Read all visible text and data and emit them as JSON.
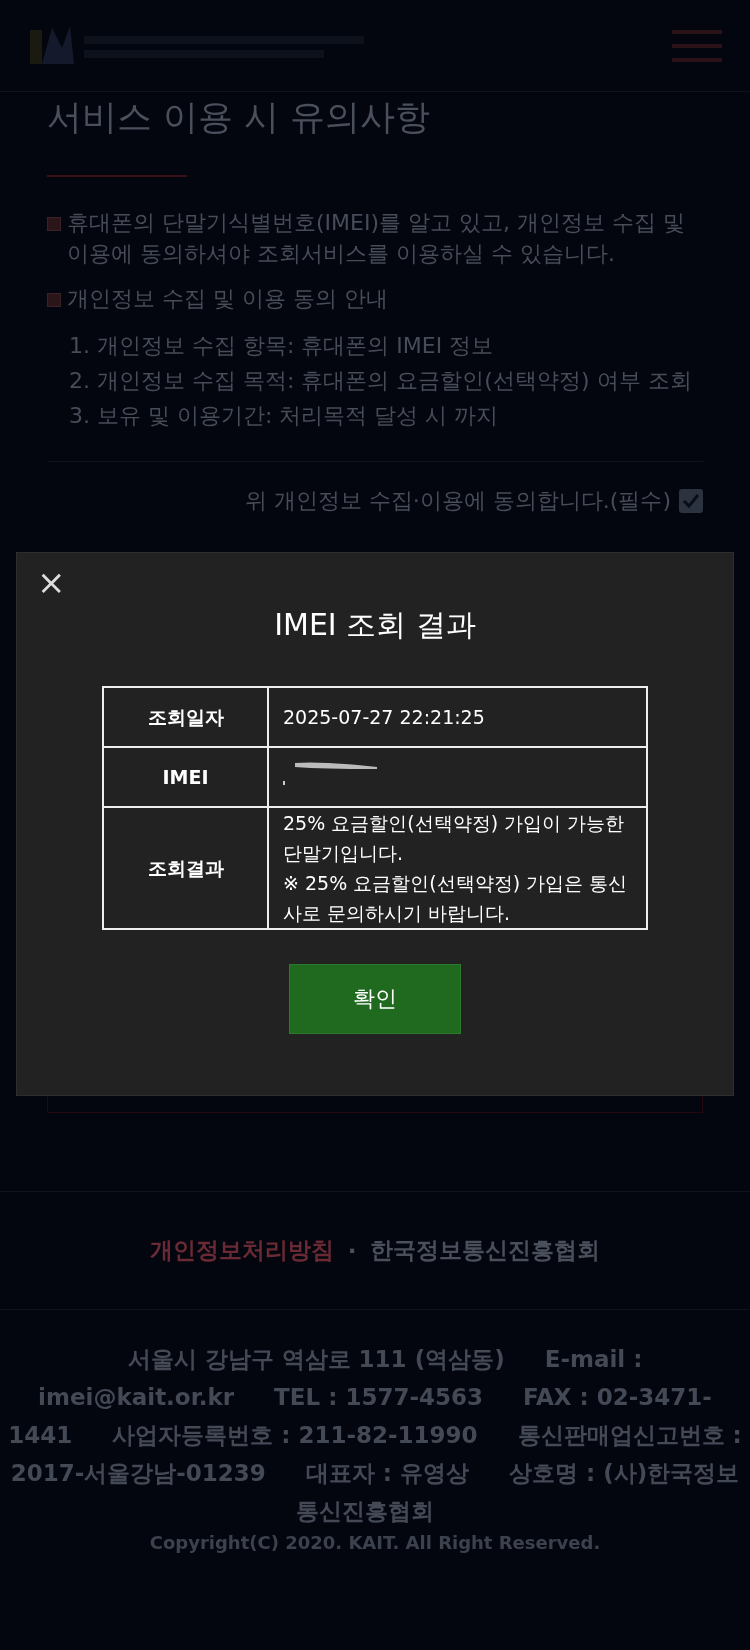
{
  "notice": {
    "title": "서비스 이용 시 유의사항",
    "bullets": [
      "휴대폰의 단말기식별번호(IMEI)를 알고 있고, 개인정보 수집 및 이용에 동의하셔야 조회서비스를 이용하실 수 있습니다.",
      "개인정보 수집 및 이용 동의 안내"
    ],
    "items": [
      "1. 개인정보 수집 항목: 휴대폰의 IMEI 정보",
      "2. 개인정보 수집 목적: 휴대폰의 요금할인(선택약정) 여부 조회",
      "3. 보유 및 이용기간: 처리목적 달성 시 까지"
    ],
    "agreement": {
      "label": "위 개인정보 수집·이용에 동의합니다.(필수)",
      "checked": true
    }
  },
  "modal": {
    "close": "×",
    "title": "IMEI 조회 결과",
    "rows": [
      {
        "label": "조회일자",
        "value": "2025-07-27 22:21:25",
        "redacted": false
      },
      {
        "label": "IMEI",
        "value": "",
        "redacted": true
      },
      {
        "label": "조회결과",
        "value": "25% 요금할인(선택약정) 가입이 가능한 단말기입니다.\n※ 25% 요금할인(선택약정) 가입은 통신사로 문의하시기 바랍니다.",
        "redacted": false
      }
    ],
    "button": "확인"
  },
  "footer": {
    "links": [
      {
        "label": "개인정보처리방침",
        "color": "#6a2a33"
      },
      {
        "label": "한국정보통신진흥협회",
        "color": "#4a4f5c"
      }
    ],
    "separator": "·",
    "info": [
      "서울시 강남구 역삼로 111 (역삼동)",
      "E-mail : imei@kait.or.kr",
      "TEL : 1577-4563",
      "FAX : 02-3471-1441",
      "사업자등록번호 : 211-82-11990",
      "통신판매업신고번호 : 2017-서울강남-01239",
      "대표자 : 유영상",
      "상호명 : (사)한국정보통신진흥협회"
    ],
    "copyright": "Copyright(C) 2020. KAIT. All Right Reserved."
  }
}
